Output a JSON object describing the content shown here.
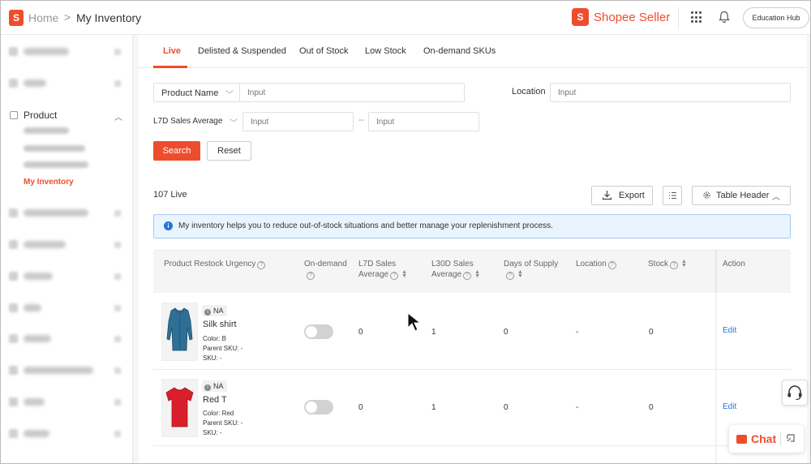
{
  "header": {
    "logo_letter": "S",
    "breadcrumb_home": "Home",
    "breadcrumb_sep": ">",
    "breadcrumb_page": "My Inventory",
    "brand_letter": "S",
    "brand_name": "Shopee Seller",
    "education_hub": "Education Hub"
  },
  "sidebar": {
    "product_label": "Product",
    "active_item": "My Inventory"
  },
  "tabs": [
    "Live",
    "Delisted & Suspended",
    "Out of Stock",
    "Low Stock",
    "On-demand SKUs"
  ],
  "filters": {
    "product_name_label": "Product Name",
    "product_name_placeholder": "Input",
    "location_label": "Location",
    "location_placeholder": "Input",
    "l7d_label": "L7D Sales Average",
    "min_placeholder": "Input",
    "max_placeholder": "Input",
    "range_sep": "--"
  },
  "actions": {
    "search": "Search",
    "reset": "Reset",
    "export": "Export",
    "table_header": "Table Header"
  },
  "summary": {
    "count": "107 Live"
  },
  "banner": {
    "text": "My inventory helps you to reduce out-of-stock situations and better manage your replenishment process."
  },
  "table": {
    "columns": {
      "urgency": "Product Restock Urgency",
      "ondemand": "On-demand",
      "l7d_line1": "L7D Sales",
      "l7d_line2": "Average",
      "l30d_line1": "L30D Sales",
      "l30d_line2": "Average",
      "days": "Days of Supply",
      "location": "Location",
      "stock": "Stock",
      "action": "Action"
    },
    "rows": [
      {
        "badge": "NA",
        "name": "Silk shirt",
        "color": "Color: B",
        "parent_sku": "Parent SKU: -",
        "sku": "SKU: -",
        "ondemand": false,
        "l7d": "0",
        "l30d": "1",
        "days": "0",
        "location": "-",
        "stock": "0",
        "action": "Edit",
        "thumb_color": "#2f6f95"
      },
      {
        "badge": "NA",
        "name": "Red T",
        "color": "Color: Red",
        "parent_sku": "Parent SKU: -",
        "sku": "SKU: -",
        "ondemand": false,
        "l7d": "0",
        "l30d": "1",
        "days": "0",
        "location": "-",
        "stock": "0",
        "action": "Edit",
        "thumb_color": "#d9202a"
      }
    ]
  },
  "chat": {
    "label": "Chat"
  },
  "colors": {
    "brand": "#ee4d2d",
    "link": "#2673dd",
    "info_bg": "#eaf4fe"
  }
}
